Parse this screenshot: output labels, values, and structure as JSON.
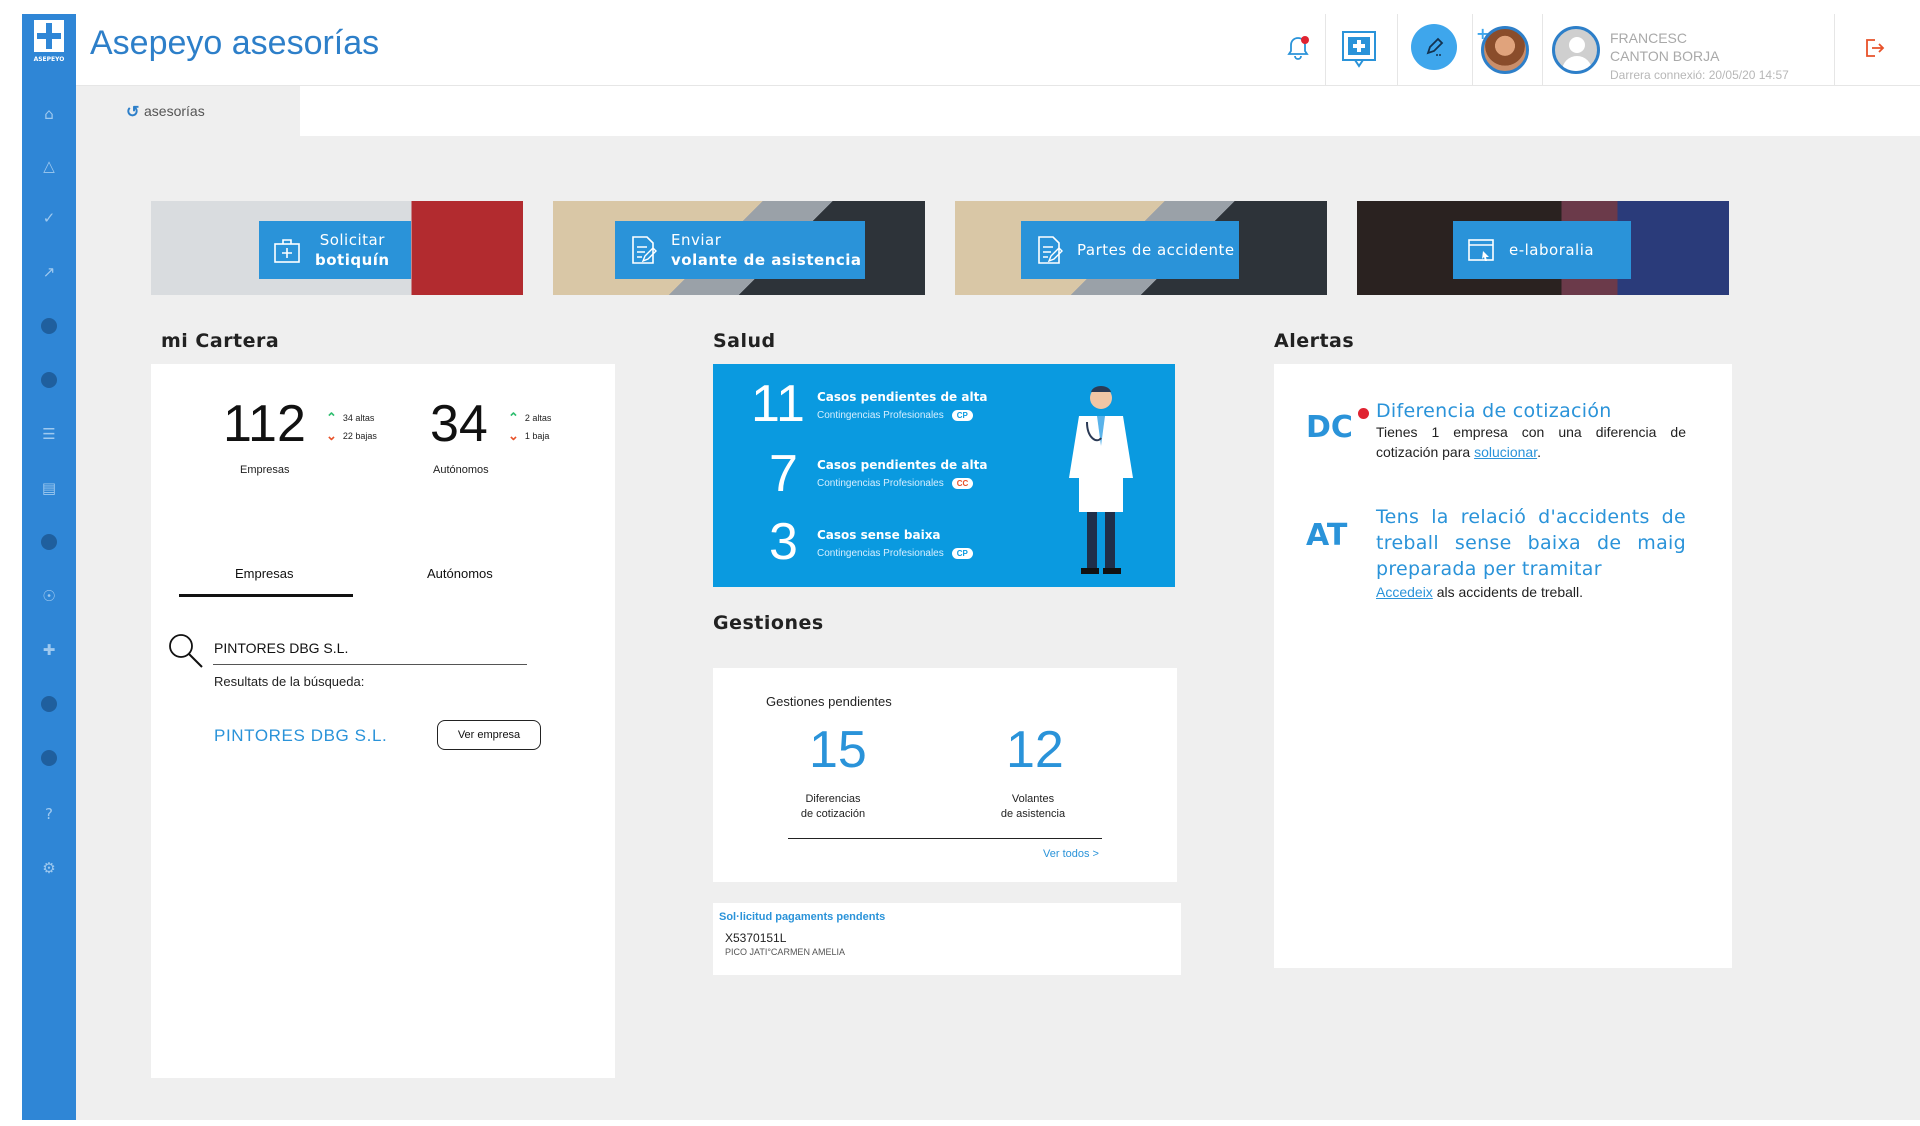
{
  "app": {
    "title": "Asepeyo asesorías",
    "logo_text": "ASEPEYO"
  },
  "header": {
    "user_first": "FRANCESC",
    "user_last": "CANTON BORJA",
    "last_connection": "Darrera connexió: 20/05/20 14:57"
  },
  "tabs": [
    {
      "label": "asesorías",
      "active": true
    }
  ],
  "banners": [
    {
      "line1": "Solicitar",
      "line2": "botiquín",
      "icon": "first-aid-kit-icon"
    },
    {
      "line1": "Enviar",
      "line2": "volante de asistencia",
      "icon": "document-edit-icon"
    },
    {
      "line1": "Partes de accidente",
      "line2": "",
      "icon": "document-edit-icon"
    },
    {
      "line1": "e-laboralia",
      "line2": "",
      "icon": "browser-window-icon"
    }
  ],
  "cartera": {
    "title": "mi Cartera",
    "empresas": {
      "value": "112",
      "label": "Empresas",
      "altas": "34 altas",
      "bajas": "22 bajas"
    },
    "autonomos": {
      "value": "34",
      "label": "Autónomos",
      "altas": "2 altas",
      "bajas": "1 baja"
    },
    "tab_empresas": "Empresas",
    "tab_autonomos": "Autónomos",
    "search_value": "PINTORES DBG S.L.",
    "results_label": "Resultats de la búsqueda:",
    "result_name": "PINTORES DBG S.L.",
    "result_button": "Ver empresa"
  },
  "salud": {
    "title": "Salud",
    "rows": [
      {
        "value": "11",
        "title": "Casos pendientes de alta",
        "sub": "Contingencias Profesionales",
        "badge": "CP"
      },
      {
        "value": "7",
        "title": "Casos pendientes de alta",
        "sub": "Contingencias Profesionales",
        "badge": "CC"
      },
      {
        "value": "3",
        "title": "Casos sense baixa",
        "sub": "Contingencias Profesionales",
        "badge": "CP"
      }
    ]
  },
  "gestiones": {
    "title": "Gestiones",
    "pending_label": "Gestiones pendientes",
    "diff_value": "15",
    "diff_label_1": "Diferencias",
    "diff_label_2": "de cotización",
    "vol_value": "12",
    "vol_label_1": "Volantes",
    "vol_label_2": "de asistencia",
    "see_all": "Ver todos >",
    "payments_title": "Sol·licitud pagaments pendents",
    "payments_id": "X5370151L",
    "payments_name": "PICO JATI°CARMEN AMELIA"
  },
  "alertas": {
    "title": "Alertas",
    "items": [
      {
        "code": "DC",
        "title": "Diferencia de cotización",
        "text_before": "Tienes 1 empresa con una diferencia de cotización para ",
        "link": "solucionar",
        "text_after": "."
      },
      {
        "code": "AT",
        "title": "Tens la relació d'accidents de treball sense baixa de maig preparada per tramitar",
        "text_before": "",
        "link": "Accedeix",
        "text_after": " als accidents de treball."
      }
    ]
  },
  "colors": {
    "brand": "#2f86d6",
    "accent": "#2a93d9",
    "salud_bg": "#0a9ae0",
    "alert_dot": "#e02331"
  }
}
